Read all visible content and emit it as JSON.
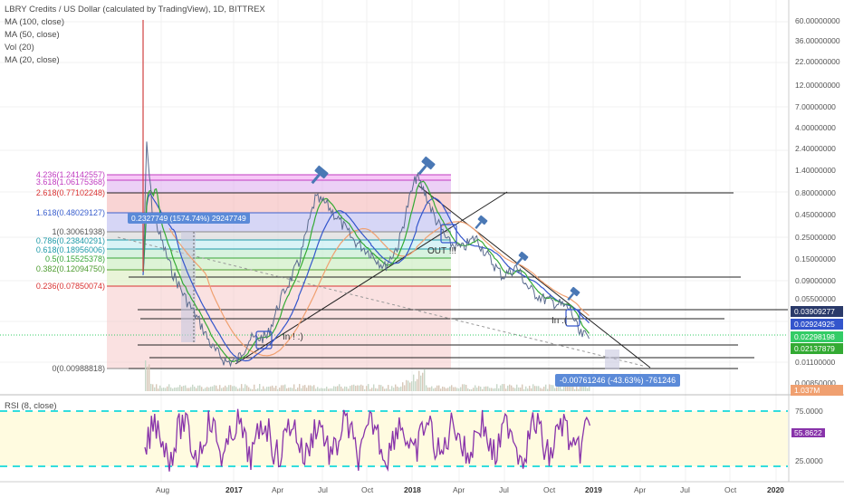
{
  "legend": {
    "title": "LBRY Credits / US Dollar (calculated by TradingView), 1D, BITTREX",
    "studies": [
      "MA (100, close)",
      "MA (50, close)",
      "Vol (20)",
      "MA (20, close)"
    ]
  },
  "rsi_label": "RSI (8, close)",
  "price_scale": [
    "60.00000000",
    "36.00000000",
    "22.00000000",
    "12.00000000",
    "7.00000000",
    "4.00000000",
    "2.40000000",
    "1.40000000",
    "0.80000000",
    "0.45000000",
    "0.25000000",
    "0.15000000",
    "0.09000000",
    "0.05500000",
    "0.01100000",
    "0.00850000"
  ],
  "tags": {
    "t1": "0.03909277",
    "t2": "0.02924925",
    "t3": "0.02298198",
    "t4": "0.02137879",
    "t5": "1.037M"
  },
  "fib_levels": [
    {
      "label": "4.236(1.24142557)",
      "color": "#c03bc0"
    },
    {
      "label": "3.618(1.06175368)",
      "color": "#c03bc0"
    },
    {
      "label": "2.618(0.77102248)",
      "color": "#d93232"
    },
    {
      "label": "1.618(0.48029127)",
      "color": "#3a5fcd"
    },
    {
      "label": "1(0.30061938)",
      "color": "#555555"
    },
    {
      "label": "0.786(0.23840291)",
      "color": "#1e9aa8"
    },
    {
      "label": "0.618(0.18956006)",
      "color": "#1e9aa8"
    },
    {
      "label": "0.5(0.15525378)",
      "color": "#3aa63a"
    },
    {
      "label": "0.382(0.12094750)",
      "color": "#4d9b2f"
    },
    {
      "label": "0.236(0.07850074)",
      "color": "#d93232"
    },
    {
      "label": "0(0.00988818)",
      "color": "#555555"
    }
  ],
  "notes": {
    "out": "OUT !!!",
    "in_smile": "In ! :)",
    "in_sad": "In :("
  },
  "measures": {
    "up": "0.2327749 (1574.74%) 29247749",
    "down": "-0.00761246 (-43.63%) -761246"
  },
  "time_axis": [
    {
      "label": "Aug",
      "year": false
    },
    {
      "label": "2017",
      "year": true
    },
    {
      "label": "Apr",
      "year": false
    },
    {
      "label": "Jul",
      "year": false
    },
    {
      "label": "Oct",
      "year": false
    },
    {
      "label": "2018",
      "year": true
    },
    {
      "label": "Apr",
      "year": false
    },
    {
      "label": "Jul",
      "year": false
    },
    {
      "label": "Oct",
      "year": false
    },
    {
      "label": "2019",
      "year": true
    },
    {
      "label": "Apr",
      "year": false
    },
    {
      "label": "Jul",
      "year": false
    },
    {
      "label": "Oct",
      "year": false
    },
    {
      "label": "2020",
      "year": true
    }
  ],
  "rsi": {
    "value": "55.8622",
    "level": "25.0000",
    "upper": "75.0000"
  },
  "colors": {
    "price": "#5b6c8f",
    "ma100": "#f0a070",
    "ma50": "#3355cc",
    "ma20": "#33aa33",
    "rsi": "#8833aa",
    "rsi_band": "#fffbe0",
    "rsi_line": "#33dddd"
  }
}
